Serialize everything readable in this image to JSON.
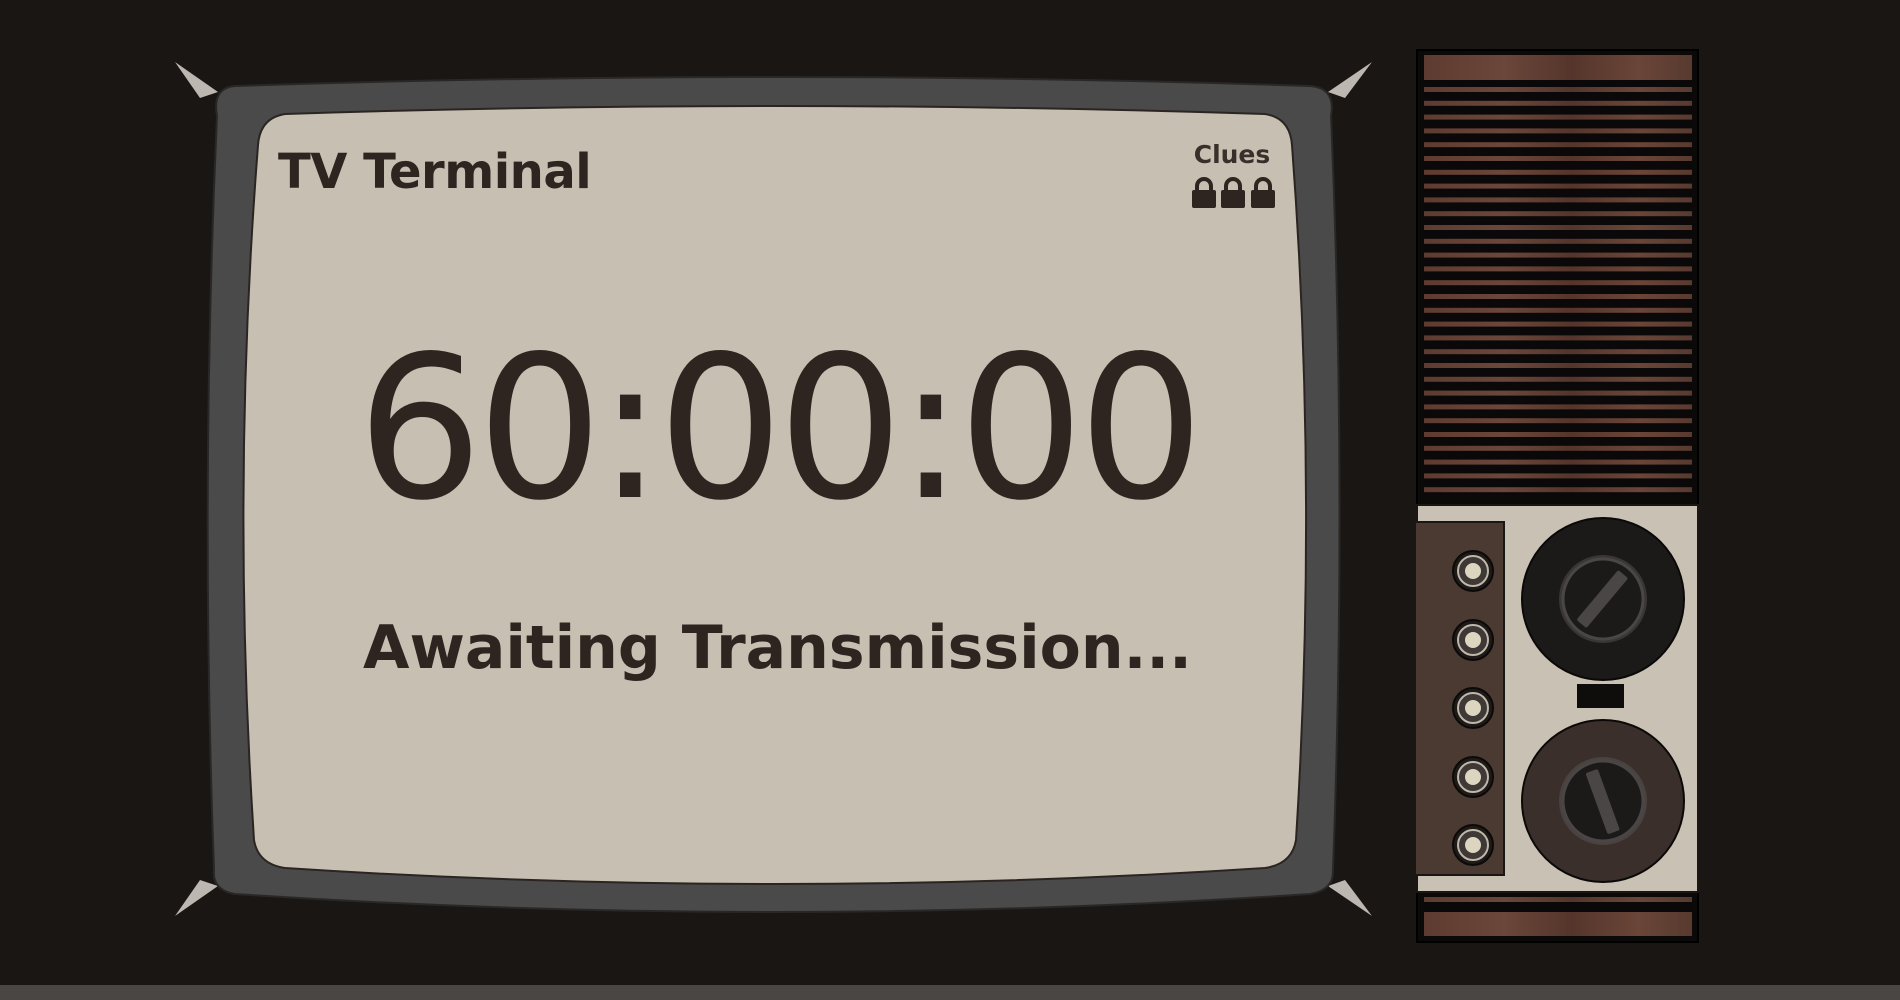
{
  "app": {
    "title": "TV Terminal"
  },
  "clues": {
    "label": "Clues",
    "locks": [
      {
        "icon": "lock-icon",
        "state": "locked"
      },
      {
        "icon": "lock-icon",
        "state": "locked"
      },
      {
        "icon": "lock-icon",
        "state": "locked"
      }
    ]
  },
  "timer": {
    "value": "60:00:00"
  },
  "status": {
    "message": "Awaiting Transmission..."
  },
  "colors": {
    "background": "#1a1613",
    "screen": "#c7bfb1",
    "bezel": "#4a4a4a",
    "text": "#2e2521",
    "wood": "#5a3a2f",
    "panel": "#4a3a32",
    "knob_dark": "#1c1a19",
    "knob_brown": "#3a2f2a"
  }
}
